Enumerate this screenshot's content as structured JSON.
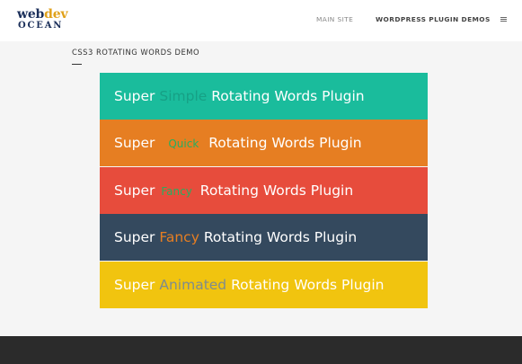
{
  "header": {
    "logo": {
      "web": "web",
      "dev": "dev",
      "ocean": "OCEAN"
    },
    "nav": {
      "main_site": "MAIN SITE",
      "plugin_demos": "WORDPRESS PLUGIN DEMOS"
    },
    "menu_icon": "hamburger-menu-icon"
  },
  "main": {
    "title": "CSS3 ROTATING WORDS DEMO",
    "panels": [
      {
        "prefix": "Super",
        "word": "Simple",
        "suffix": "Rotating Words Plugin",
        "bg": "#1abc9c",
        "word_color": "#16a085"
      },
      {
        "prefix": "Super",
        "word": "Quick",
        "suffix": "Rotating Words Plugin",
        "bg": "#e67e22",
        "word_color": "#27ae60"
      },
      {
        "prefix": "Super",
        "word": "Fancy",
        "suffix": "Rotating Words Plugin",
        "bg": "#e74c3c",
        "word_color": "#27ae60"
      },
      {
        "prefix": "Super",
        "word": "Fancy",
        "suffix": "Rotating Words Plugin",
        "bg": "#34495e",
        "word_color": "#e67e22"
      },
      {
        "prefix": "Super",
        "word": "Animated",
        "suffix": "Rotating Words Plugin",
        "bg": "#f1c40f",
        "word_color": "#7f8c8d"
      }
    ]
  },
  "colors": {
    "page_bg": "#f5f5f5",
    "footer_bg": "#2b2b2b",
    "logo_navy": "#1b2f5a",
    "logo_gold": "#e0a11a"
  }
}
